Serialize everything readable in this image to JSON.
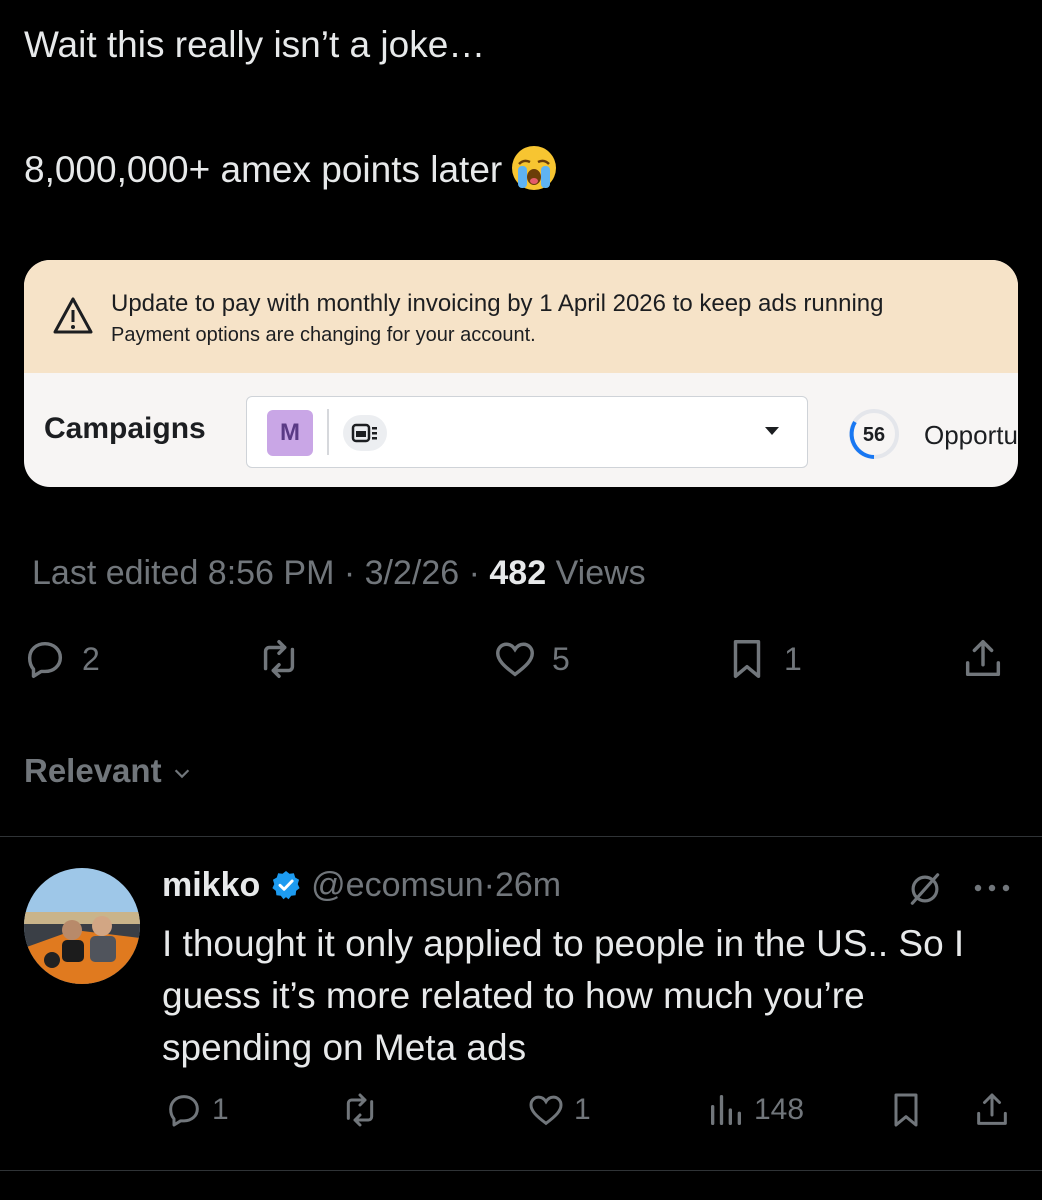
{
  "tweet": {
    "line1": "Wait this really isn’t a joke…",
    "line2": "8,000,000+ amex points later",
    "emoji": "loudly-crying-face"
  },
  "ad_card": {
    "banner_title": "Update to pay with monthly invoicing by 1 April 2026 to keep ads running",
    "banner_sub": "Payment options are changing for your account.",
    "campaigns_label": "Campaigns",
    "account_badge": "M",
    "score": "56",
    "opportunity_label": "Opportu"
  },
  "meta": {
    "edited": "Last edited 8:56 PM · 3/2/26",
    "dot": " · ",
    "views_count": "482",
    "views_label": " Views"
  },
  "actions": {
    "replies": "2",
    "likes": "5",
    "bookmarks": "1"
  },
  "sort": {
    "label": "Relevant"
  },
  "reply": {
    "name": "mikko",
    "handle": "@ecomsun",
    "time": "26m",
    "dot": "·",
    "text": "I thought it only applied to people in the US.. So I guess it’s more related to how much you’re spending on Meta ads",
    "replies": "1",
    "likes": "1",
    "views": "148"
  },
  "colors": {
    "verified": "#1d9bf0",
    "muted": "#71767b",
    "text": "#e7e9ea"
  }
}
